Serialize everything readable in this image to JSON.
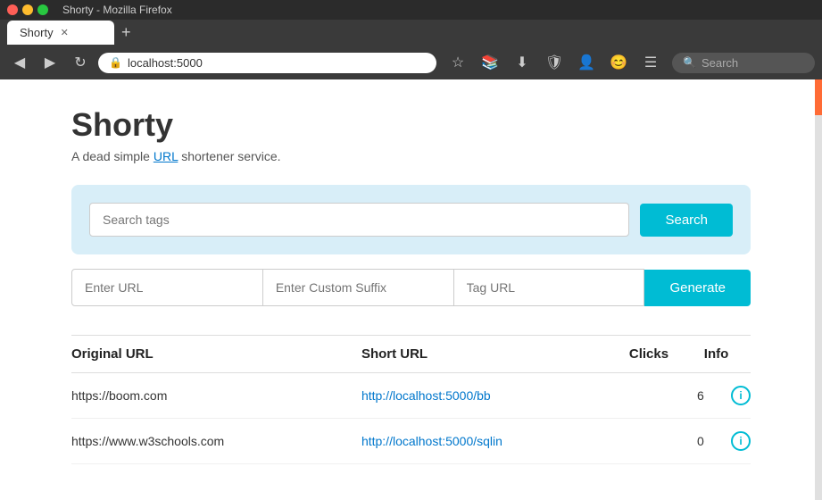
{
  "browser": {
    "title": "Shorty - Mozilla Firefox",
    "tab_label": "Shorty",
    "url": "localhost:5000",
    "search_placeholder": "Search"
  },
  "header": {
    "title": "Shorty",
    "subtitle_before": "A dead simple ",
    "subtitle_url_text": "URL",
    "subtitle_after": " shortener service."
  },
  "search_panel": {
    "tags_placeholder": "Search tags",
    "search_button": "Search"
  },
  "url_form": {
    "url_placeholder": "Enter URL",
    "suffix_placeholder": "Enter Custom Suffix",
    "tag_placeholder": "Tag URL",
    "generate_button": "Generate"
  },
  "table": {
    "headers": {
      "original": "Original URL",
      "short": "Short URL",
      "clicks": "Clicks",
      "info": "Info"
    },
    "rows": [
      {
        "original": "https://boom.com",
        "short": "http://localhost:5000/bb",
        "clicks": "6"
      },
      {
        "original": "https://www.w3schools.com",
        "short": "http://localhost:5000/sqlin",
        "clicks": "0"
      }
    ]
  },
  "icons": {
    "back": "◀",
    "forward": "▶",
    "refresh": "↻",
    "lock": "🔒",
    "bookmark": "☆",
    "library": "📚",
    "download": "⬇",
    "shield": "🛡",
    "account": "👤",
    "emoji": "😊",
    "menu": "☰",
    "search_mag": "🔍",
    "close": "✕",
    "new_tab": "+",
    "info_i": "i"
  }
}
